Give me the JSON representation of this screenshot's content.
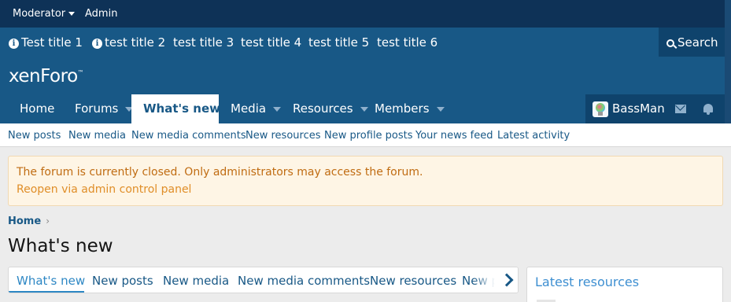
{
  "staff_bar": {
    "moderator": "Moderator",
    "admin": "Admin"
  },
  "notices": [
    {
      "label": "Test title 1",
      "icon": "info-icon"
    },
    {
      "label": "test title 2",
      "icon": "info-icon"
    },
    {
      "label": "test title 3"
    },
    {
      "label": "test title 4"
    },
    {
      "label": "test title 5"
    },
    {
      "label": "test title 6"
    }
  ],
  "search": {
    "label": "Search"
  },
  "logo": {
    "text": "xenForo",
    "mark": "™"
  },
  "nav": {
    "tabs": [
      {
        "label": "Home"
      },
      {
        "label": "Forums"
      },
      {
        "label": "What's new"
      },
      {
        "label": "Media"
      },
      {
        "label": "Resources"
      },
      {
        "label": "Members"
      }
    ],
    "user": {
      "name": "BassMan"
    }
  },
  "subnav": [
    "New posts",
    "New media",
    "New media comments",
    "New resources",
    "New profile posts",
    "Your news feed",
    "Latest activity"
  ],
  "notice": {
    "text": "The forum is currently closed. Only administrators may access the forum.",
    "link": "Reopen via admin control panel"
  },
  "breadcrumb": {
    "home": "Home",
    "chevron": "›"
  },
  "page_title": "What's new",
  "content_tabs": [
    "What's new",
    "New posts",
    "New media",
    "New media comments",
    "New resources",
    "New p"
  ],
  "sidebar": {
    "title": "Latest resources"
  },
  "colors": {
    "staff_bar": "#0e3257",
    "header": "#185886",
    "accent": "#2d87c4",
    "notice_bg": "#fef5e5",
    "notice_text": "#c06c12"
  }
}
